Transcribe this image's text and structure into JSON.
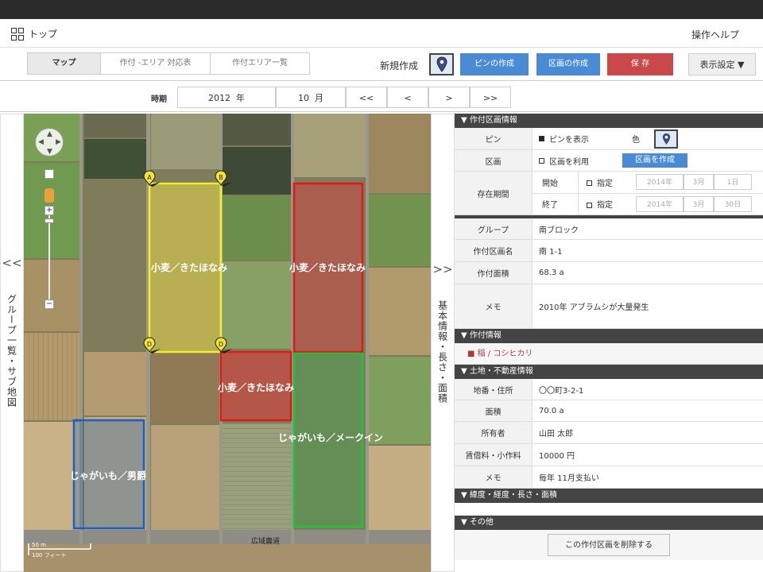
{
  "header": {
    "home_label": "トップ",
    "help_label": "操作ヘルプ"
  },
  "toolbar": {
    "tabs": [
      {
        "label": "マップ",
        "active": true
      },
      {
        "label": "作付 -エリア 対応表",
        "active": false
      },
      {
        "label": "作付エリア一覧",
        "active": false
      }
    ],
    "new_label": "新規作成",
    "pin_create": "ピンの作成",
    "area_create": "区画の作成",
    "save": "保 存",
    "display_settings": "表示設定 ▼"
  },
  "period": {
    "label": "時期",
    "year": "2012",
    "year_unit": "年",
    "month": "10",
    "month_unit": "月",
    "nav": [
      "<<",
      "<",
      ">",
      ">>"
    ]
  },
  "left_strip": {
    "arrow": "<<",
    "text": "グループ一覧・サブ地図"
  },
  "right_strip": {
    "arrow": ">>",
    "text": "基本情報・長さ・面積"
  },
  "map": {
    "markers": [
      "A",
      "B",
      "D",
      "D"
    ],
    "labels": [
      "小麦／きたほなみ",
      "小麦／きたほなみ",
      "小麦／きたほなみ",
      "じゃがいも／メークイン",
      "じゃがいも／男爵"
    ],
    "road_name": "広域農道",
    "scale_top": "50 m",
    "scale_bottom": "100 フィート"
  },
  "panel": {
    "sec_area": "▼ 作付区画情報",
    "pin_key": "ピン",
    "pin_show": "ピンを表示",
    "color_label": "色",
    "parcel_key": "区画",
    "parcel_use": "区画を利用",
    "parcel_make": "区画を作成",
    "period_key": "存在期間",
    "start_label": "開始",
    "end_label": "終了",
    "specify": "指定",
    "start_date": {
      "year": "2014年",
      "month": "3月",
      "day": "1日"
    },
    "end_date": {
      "year": "2014年",
      "month": "3月",
      "day": "30日"
    },
    "group_key": "グループ",
    "group_val": "南ブロック",
    "name_key": "作付区画名",
    "name_val": "南 1-1",
    "area_key": "作付面積",
    "area_val": "68.3 a",
    "memo_key": "メモ",
    "memo_val": "2010年 アブラムシが大量発生",
    "sec_crop": "▼ 作付情報",
    "crop_val": "■ 稲 / コシヒカリ",
    "sec_land": "▼ 土地・不動産情報",
    "addr_key": "地番・住所",
    "addr_val": "〇〇町3-2-1",
    "land_area_key": "面積",
    "land_area_val": "70.0 a",
    "owner_key": "所有者",
    "owner_val": "山田 太郎",
    "rent_key": "賃借料・小作料",
    "rent_val": "10000 円",
    "memo2_key": "メモ",
    "memo2_val": "毎年 11月支払い",
    "sec_geo": "▼ 緯度・経度・長さ・面積",
    "sec_other": "▼ その他",
    "delete_btn": "この作付区画を削除する"
  },
  "colors": {
    "accent_blue": "#4a8bd6",
    "save_red": "#c9484a",
    "wheat_yellow": "#e8d84a",
    "wheat_red": "#e0393b",
    "potato_green": "#33b24a",
    "potato_blue": "#1f5fb5",
    "crop_red": "#b03a3a"
  }
}
